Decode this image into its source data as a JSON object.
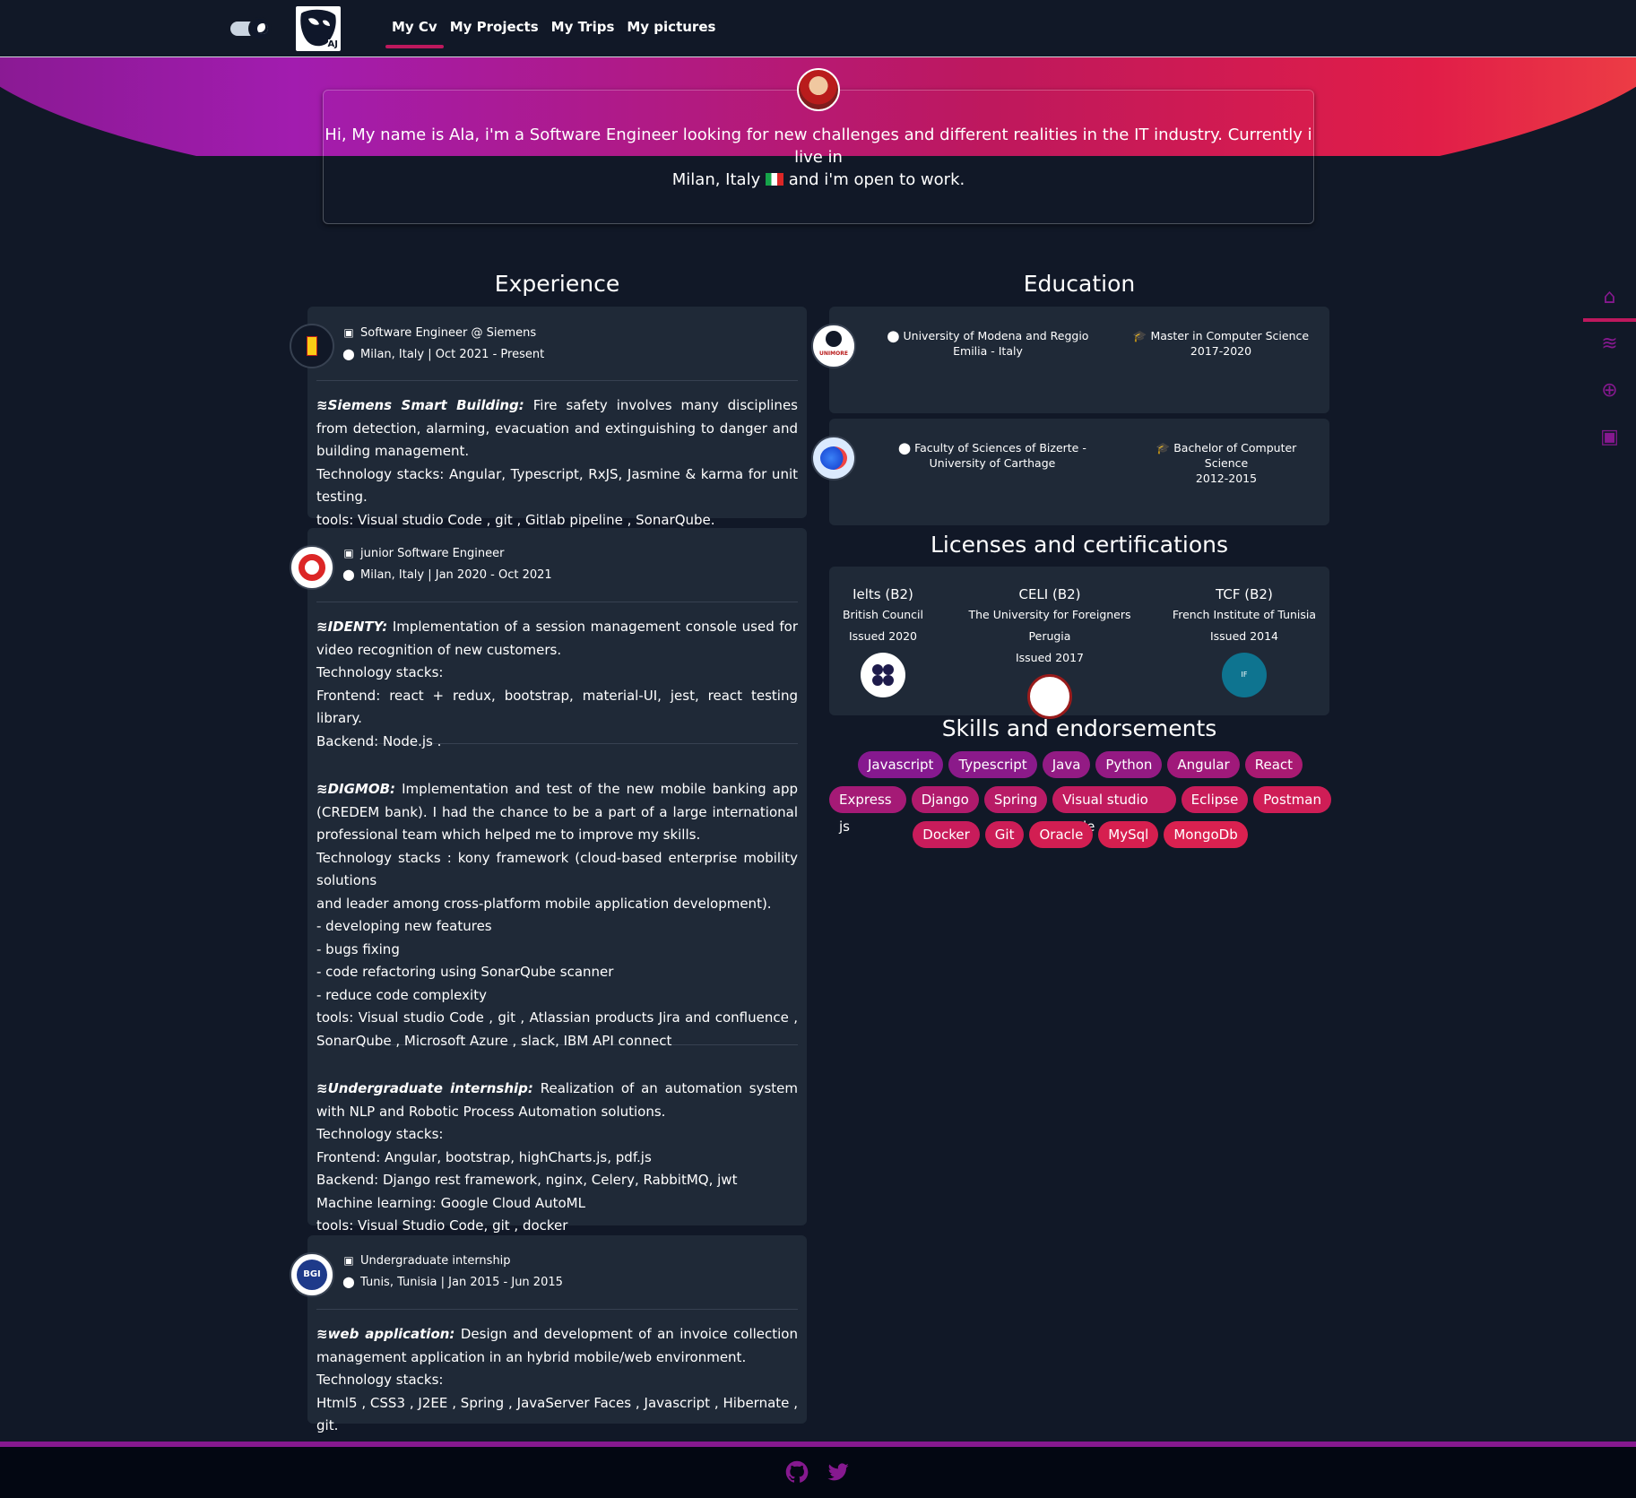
{
  "nav": {
    "logo_text": "AJ",
    "items": [
      {
        "label": "My Cv"
      },
      {
        "label": "My Projects"
      },
      {
        "label": "My Trips"
      },
      {
        "label": "My pictures"
      }
    ]
  },
  "hero": {
    "line1": "Hi, My name is Ala, i'm a Software Engineer looking for new challenges and different realities in the IT industry. Currently i live in",
    "line2a": "Milan, Italy",
    "line2b": "and i'm open to work."
  },
  "experience": {
    "title": "Experience",
    "jobs": [
      {
        "role": "Software Engineer @ Siemens",
        "location": "Milan, Italy | Oct 2021 - Present",
        "projects": [
          {
            "title": "Siemens Smart Building:",
            "intro": " Fire safety involves many disciplines from detection, alarming, evacuation and extinguishing to danger and building management.",
            "lines": [
              "Technology stacks: Angular, Typescript, RxJS, Jasmine & karma for unit testing.",
              "tools: Visual studio Code , git , Gitlab pipeline , SonarQube."
            ]
          }
        ]
      },
      {
        "role": "junior Software Engineer",
        "location": "Milan, Italy | Jan 2020 - Oct 2021",
        "projects": [
          {
            "title": "IDENTY:",
            "intro": " Implementation of a session management console used for video recognition of new customers.",
            "lines": [
              "Technology stacks:",
              "Frontend: react + redux, bootstrap, material-UI, jest, react testing library.",
              "Backend: Node.js ."
            ]
          },
          {
            "title": "DIGMOB:",
            "intro": " Implementation and test of the new mobile banking app (CREDEM bank). I had the chance to be a part of a large international professional team which helped me to improve my skills.",
            "lines": [
              "Technology stacks : kony framework (cloud-based enterprise mobility solutions",
              "and leader among cross-platform mobile application development).",
              "- developing new features",
              "- bugs fixing",
              "- code refactoring using SonarQube scanner",
              "- reduce code complexity",
              "tools: Visual studio Code , git , Atlassian products Jira and confluence , SonarQube , Microsoft Azure , slack, IBM API connect"
            ]
          },
          {
            "title": "Undergraduate internship:",
            "intro": " Realization of an automation system with NLP and Robotic Process Automation solutions.",
            "lines": [
              "Technology stacks:",
              "Frontend: Angular, bootstrap, highCharts.js, pdf.js",
              "Backend: Django rest framework, nginx, Celery, RabbitMQ, jwt",
              "Machine learning: Google Cloud AutoML",
              "tools: Visual Studio Code, git , docker"
            ]
          }
        ]
      },
      {
        "role": "Undergraduate internship",
        "location": "Tunis, Tunisia | Jan 2015 - Jun 2015",
        "projects": [
          {
            "title": "web application:",
            "intro": " Design and development of an invoice collection management application in an hybrid mobile/web environment.",
            "lines": [
              "Technology stacks:",
              "Html5 , CSS3 , J2EE , Spring , JavaServer Faces , Javascript , Hibernate , git."
            ]
          }
        ]
      }
    ]
  },
  "education": {
    "title": "Education",
    "items": [
      {
        "school": "University of Modena and Reggio Emilia - Italy",
        "degree": "Master in Computer Science",
        "years": "2017-2020",
        "logo_text": "UNIMORE"
      },
      {
        "school": "Faculty of Sciences of Bizerte - University of Carthage",
        "degree": "Bachelor of Computer Science",
        "years": "2012-2015"
      }
    ]
  },
  "certifications": {
    "title": "Licenses and certifications",
    "items": [
      {
        "name": "Ielts (B2)",
        "issuer": "British Council",
        "issued": "Issued 2020",
        "color": "#1e1b4b"
      },
      {
        "name": "CELI (B2)",
        "issuer": "The University for Foreigners Perugia",
        "issued": "Issued 2017",
        "color": "#991b1b"
      },
      {
        "name": "TCF (B2)",
        "issuer": "French Institute of Tunisia",
        "issued": "Issued 2014",
        "color": "#0e7490"
      }
    ]
  },
  "skills": {
    "title": "Skills and endorsements",
    "rows": [
      [
        {
          "label": "Javascript",
          "color": "#86198f"
        },
        {
          "label": "Typescript",
          "color": "#8b1a8a"
        },
        {
          "label": "Java",
          "color": "#931b84"
        },
        {
          "label": "Python",
          "color": "#941a83"
        },
        {
          "label": "Angular",
          "color": "#a0197a"
        },
        {
          "label": "React",
          "color": "#a91a72"
        }
      ],
      [
        {
          "label": "Express js",
          "color": "#a51a76"
        },
        {
          "label": "Django",
          "color": "#b01a6c"
        },
        {
          "label": "Spring",
          "color": "#b81b66"
        },
        {
          "label": "Visual studio code",
          "color": "#c21c5f"
        },
        {
          "label": "Eclipse",
          "color": "#c91c5a"
        },
        {
          "label": "Postman",
          "color": "#cf1d56"
        }
      ],
      [
        {
          "label": "Docker",
          "color": "#c81c5b"
        },
        {
          "label": "Git",
          "color": "#cd1d57"
        },
        {
          "label": "Oracle",
          "color": "#d21e52"
        },
        {
          "label": "MySql",
          "color": "#d61f4f"
        },
        {
          "label": "MongoDb",
          "color": "#da2150"
        }
      ]
    ]
  },
  "sidenav": {
    "items": [
      {
        "icon": "home-icon",
        "glyph": "⌂"
      },
      {
        "icon": "layers-icon",
        "glyph": "≋"
      },
      {
        "icon": "globe-icon",
        "glyph": "⊕"
      },
      {
        "icon": "image-icon",
        "glyph": "▣"
      }
    ]
  },
  "footer": {
    "icons": [
      "github-icon",
      "twitter-icon"
    ]
  }
}
